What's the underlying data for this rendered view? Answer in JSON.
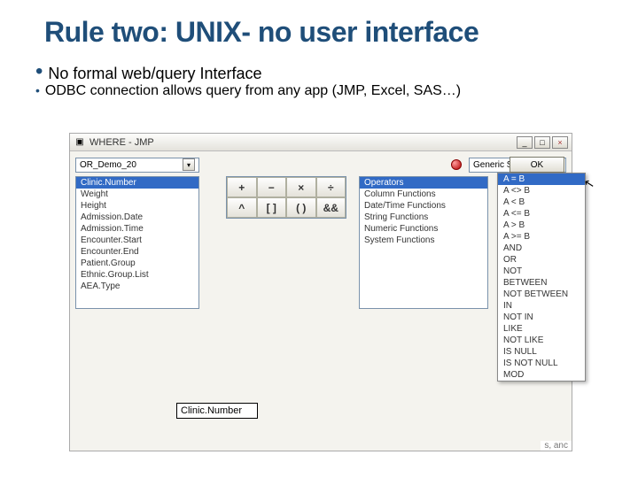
{
  "title": "Rule two: UNIX- no user interface",
  "bullets": {
    "line1": "No formal web/query Interface",
    "line2": "ODBC connection allows query from any app (JMP, Excel, SAS…)"
  },
  "jmp": {
    "titlebar": "WHERE - JMP",
    "cursor_glyph": "↖",
    "combo_table": "OR_Demo_20",
    "combo_generic": "Generic SQL",
    "ok_label": "OK",
    "columns": [
      "Clinic.Number",
      "Weight",
      "Height",
      "Admission.Date",
      "Admission.Time",
      "Encounter.Start",
      "Encounter.End",
      "Patient.Group",
      "Ethnic.Group.List",
      "AEA.Type"
    ],
    "ops": [
      "+",
      "−",
      "×",
      "÷",
      "^",
      "[ ]",
      "( )",
      "&&"
    ],
    "funcs_top": "Operators",
    "funcs": [
      "Column Functions",
      "Date/Time Functions",
      "String Functions",
      "Numeric Functions",
      "System Functions"
    ],
    "menu": [
      "A = B",
      "A <> B",
      "A < B",
      "A <= B",
      "A > B",
      "A >= B",
      "AND",
      "OR",
      "NOT",
      "BETWEEN",
      "NOT BETWEEN",
      "IN",
      "NOT IN",
      "LIKE",
      "NOT LIKE",
      "IS NULL",
      "IS NOT NULL",
      "MOD"
    ],
    "clinic_label": "Clinic.Number",
    "corner": "s, anc"
  }
}
